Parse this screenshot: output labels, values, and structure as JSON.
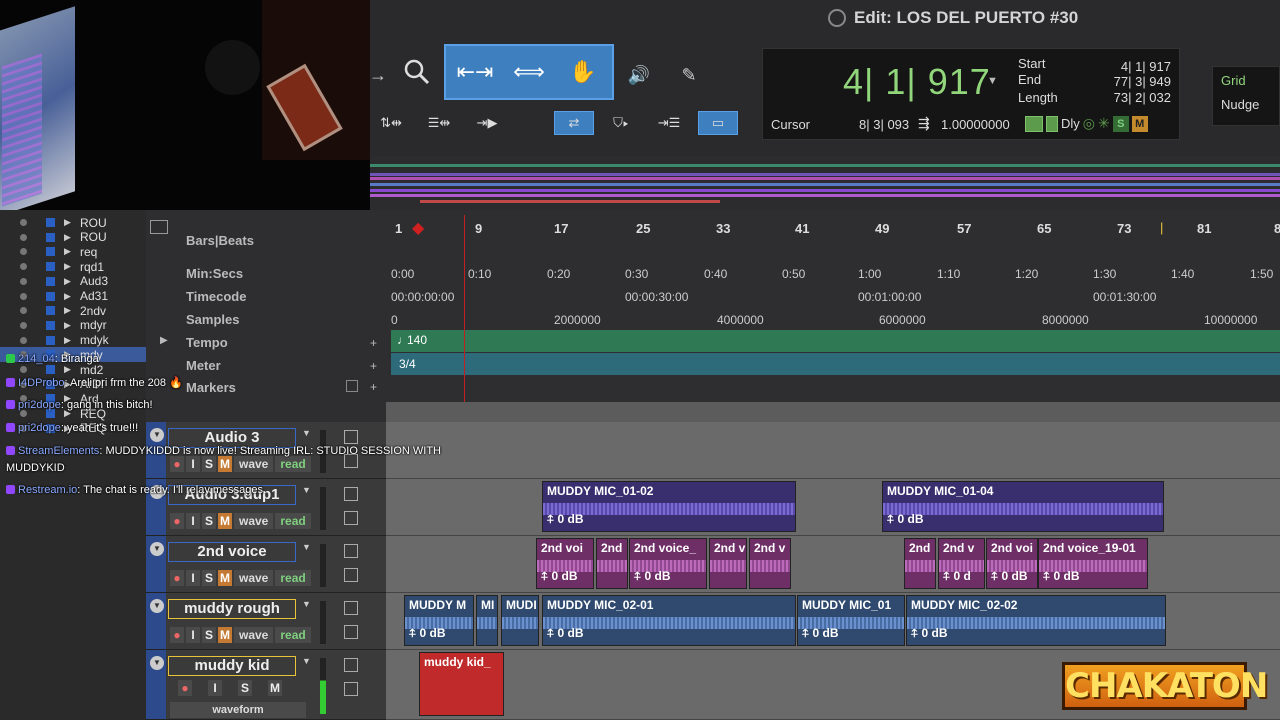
{
  "window": {
    "title": "Edit: LOS DEL PUERTO #30"
  },
  "counter": {
    "main": "4| 1| 917",
    "start_label": "Start",
    "start_value": "4| 1| 917",
    "end_label": "End",
    "end_value": "77| 3| 949",
    "length_label": "Length",
    "length_value": "73| 2| 032",
    "cursor_label": "Cursor",
    "cursor_value": "8| 3| 093",
    "nudge_value": "1.00000000",
    "dly_label": "Dly",
    "s_label": "S",
    "m_label": "M"
  },
  "grid": {
    "grid_label": "Grid",
    "nudge_label": "Nudge"
  },
  "track_list": [
    {
      "name": "ROU"
    },
    {
      "name": "ROU"
    },
    {
      "name": "req"
    },
    {
      "name": "rqd1"
    },
    {
      "name": "Aud3"
    },
    {
      "name": "Ad31"
    },
    {
      "name": "2ndv"
    },
    {
      "name": "mdyr"
    },
    {
      "name": "mdyk"
    },
    {
      "name": "mdy",
      "selected": true
    },
    {
      "name": "md2"
    },
    {
      "name": "ArDI"
    },
    {
      "name": "Ard"
    },
    {
      "name": "REQ"
    },
    {
      "name": "REQ"
    }
  ],
  "chat": [
    {
      "user": "214_04",
      "text": "Biranga"
    },
    {
      "user": "I4DProbo",
      "text": "Areli pri frm the 208 🔥"
    },
    {
      "user": "pri2dope",
      "text": "gang in this bitch!"
    },
    {
      "user": "pri2dope",
      "text": "yeah it's true!!!"
    },
    {
      "user": "StreamElements",
      "text": "MUDDYKIDDD is now live! Streaming IRL: STUDIO SESSION WITH"
    },
    {
      "user": "",
      "text": "MUDDYKID"
    },
    {
      "user": "Restream.io",
      "text": "The chat is ready. I'll relay messages."
    }
  ],
  "rulers": {
    "bars_label": "Bars|Beats",
    "minsecs_label": "Min:Secs",
    "timecode_label": "Timecode",
    "samples_label": "Samples",
    "tempo_label": "Tempo",
    "meter_label": "Meter",
    "markers_label": "Markers",
    "bars": [
      "1",
      "9",
      "17",
      "25",
      "33",
      "41",
      "49",
      "57",
      "65",
      "73",
      "81",
      "8"
    ],
    "minsecs": [
      "0:00",
      "0:10",
      "0:20",
      "0:30",
      "0:40",
      "0:50",
      "1:00",
      "1:10",
      "1:20",
      "1:30",
      "1:40",
      "1:50"
    ],
    "timecode": [
      "00:00:00:00",
      "00:00:30:00",
      "00:01:00:00",
      "00:01:30:00"
    ],
    "samples": [
      "0",
      "2000000",
      "4000000",
      "6000000",
      "8000000",
      "10000000"
    ],
    "tempo_value": "140",
    "meter_value": "3/4"
  },
  "tracks": [
    {
      "name": "Audio 3",
      "btn_i": "I",
      "btn_s": "S",
      "btn_m": "M",
      "view": "wave",
      "auto": "read",
      "clips": []
    },
    {
      "name": "Audio 3.dup1",
      "btn_i": "I",
      "btn_s": "S",
      "btn_m": "M",
      "view": "wave",
      "auto": "read",
      "clips": [
        {
          "name": "MUDDY MIC_01-02",
          "gain": "0 dB"
        },
        {
          "name": "MUDDY MIC_01-04",
          "gain": "0 dB"
        }
      ]
    },
    {
      "name": "2nd voice",
      "btn_i": "I",
      "btn_s": "S",
      "btn_m": "M",
      "view": "wave",
      "auto": "read",
      "clips": [
        {
          "name": "2nd voi",
          "gain": "0 dB"
        },
        {
          "name": "2nd",
          "gain": ""
        },
        {
          "name": "2nd voice_",
          "gain": "0 dB"
        },
        {
          "name": "2nd v",
          "gain": ""
        },
        {
          "name": "2nd v",
          "gain": ""
        },
        {
          "name": "2nd",
          "gain": ""
        },
        {
          "name": "2nd v",
          "gain": "0 d"
        },
        {
          "name": "2nd voi",
          "gain": "0 dB"
        },
        {
          "name": "2nd voice_19-01",
          "gain": "0 dB"
        }
      ]
    },
    {
      "name": "muddy rough",
      "btn_i": "I",
      "btn_s": "S",
      "btn_m": "M",
      "view": "wave",
      "auto": "read",
      "clips": [
        {
          "name": "MUDDY M",
          "gain": "0 dB"
        },
        {
          "name": "MI",
          "gain": ""
        },
        {
          "name": "MUDI",
          "gain": ""
        },
        {
          "name": "MUDDY MIC_02-01",
          "gain": "0 dB"
        },
        {
          "name": "MUDDY MIC_01",
          "gain": "0 dB"
        },
        {
          "name": "MUDDY MIC_02-02",
          "gain": "0 dB"
        }
      ]
    },
    {
      "name": "muddy kid",
      "btn_i": "I",
      "btn_s": "S",
      "btn_m": "M",
      "view": "waveform",
      "auto": "",
      "clips": [
        {
          "name": "muddy kid_",
          "gain": ""
        }
      ]
    }
  ],
  "logo": {
    "text": "CHAKATON"
  }
}
